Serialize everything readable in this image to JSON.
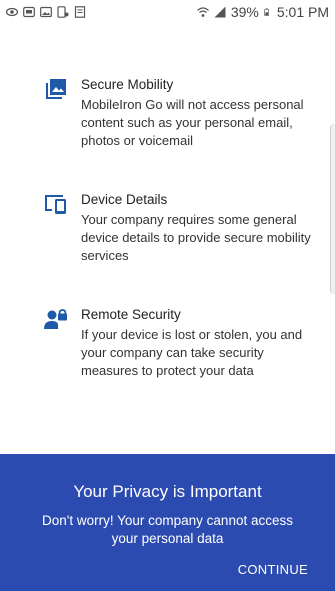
{
  "status_bar": {
    "battery": "39%",
    "time": "5:01 PM"
  },
  "features": [
    {
      "icon": "photo-library-icon",
      "title": "Secure Mobility",
      "body": "MobileIron Go will not access personal content such as your personal email, photos or voicemail"
    },
    {
      "icon": "devices-icon",
      "title": "Device Details",
      "body": "Your company requires some general device details to provide secure mobility services"
    },
    {
      "icon": "user-lock-icon",
      "title": "Remote Security",
      "body": "If your device is lost or stolen, you and your company can take security measures to protect your data"
    }
  ],
  "footer": {
    "heading": "Your Privacy is Important",
    "subtext": "Don't worry! Your company cannot access your personal data",
    "continue_label": "CONTINUE"
  },
  "colors": {
    "accent": "#2c4bb0",
    "icon": "#1e5aa8"
  }
}
